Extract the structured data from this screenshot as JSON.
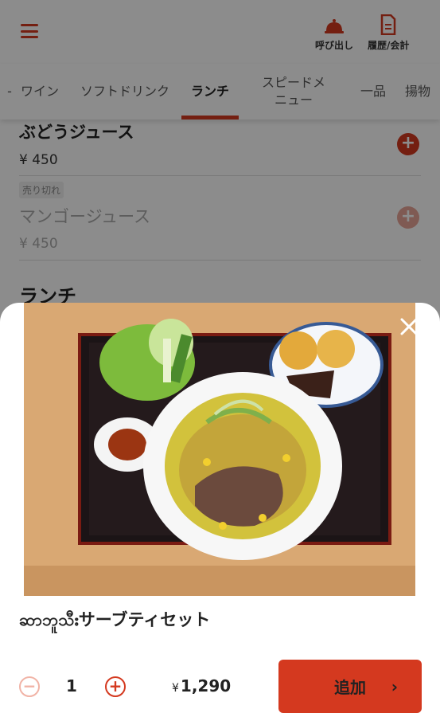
{
  "header": {
    "call_label": "呼び出し",
    "history_label": "履歴/会計"
  },
  "tabs": [
    {
      "label": "ワイン"
    },
    {
      "label": "ソフトドリンク"
    },
    {
      "label": "ランチ"
    },
    {
      "label": "スピードメ\nニュー"
    },
    {
      "label": "一品"
    },
    {
      "label": "揚物"
    }
  ],
  "menu": {
    "items": [
      {
        "name": "ぶどうジュース",
        "price": "¥ 450"
      },
      {
        "name": "マンゴージュース",
        "price": "¥ 450",
        "badge": "売り切れ"
      }
    ],
    "section_title": "ランチ"
  },
  "sheet": {
    "dish_name": "ဆာဘူသီးサーブティセット",
    "quantity": "1",
    "minus_label": "−",
    "plus_label": "+",
    "price_currency": "¥",
    "price_value": "1,290",
    "add_label": "追加",
    "add_chevron": "›",
    "close_label": "×"
  },
  "colors": {
    "accent": "#d4391f",
    "accent_light": "#f1b3a6"
  }
}
